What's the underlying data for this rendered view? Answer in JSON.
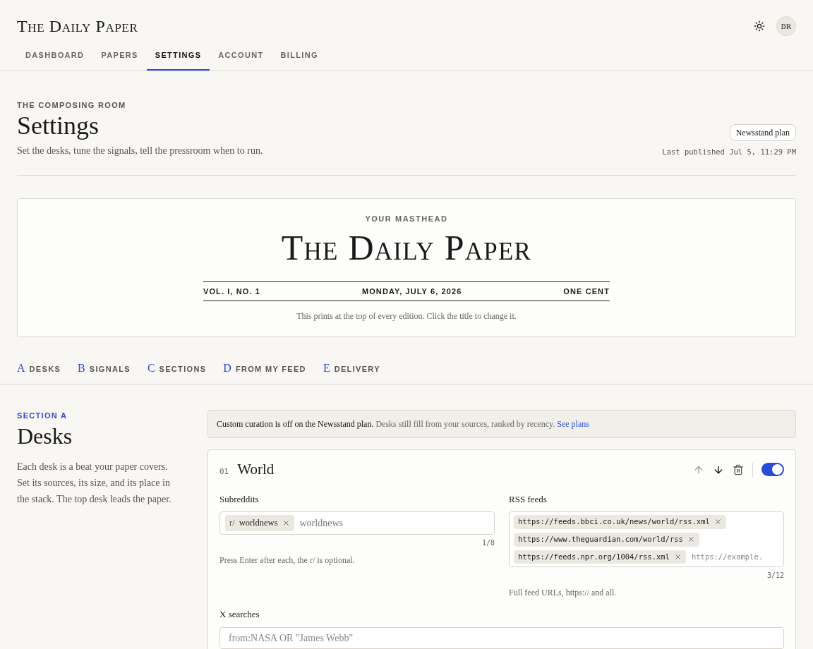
{
  "brand": "The Daily Paper",
  "user": {
    "initials": "DR"
  },
  "tabs": [
    {
      "label": "DASHBOARD",
      "selected": false
    },
    {
      "label": "PAPERS",
      "selected": false
    },
    {
      "label": "SETTINGS",
      "selected": true
    },
    {
      "label": "ACCOUNT",
      "selected": false
    },
    {
      "label": "BILLING",
      "selected": false
    }
  ],
  "page": {
    "eyebrow": "THE COMPOSING ROOM",
    "title": "Settings",
    "subtitle": "Set the desks, tune the signals, tell the pressroom when to run.",
    "plan_badge": "Newsstand plan",
    "last_published": "Last published Jul 5, 11:29 PM"
  },
  "masthead": {
    "eyebrow": "YOUR MASTHEAD",
    "title": "The Daily Paper",
    "volume": "VOL. I, NO. 1",
    "date": "MONDAY, JULY 6, 2026",
    "price": "ONE CENT",
    "note": "This prints at the top of every edition. Click the title to change it."
  },
  "section_nav": [
    {
      "letter": "A",
      "label": "DESKS"
    },
    {
      "letter": "B",
      "label": "SIGNALS"
    },
    {
      "letter": "C",
      "label": "SECTIONS"
    },
    {
      "letter": "D",
      "label": "FROM MY FEED"
    },
    {
      "letter": "E",
      "label": "DELIVERY"
    }
  ],
  "section": {
    "eyebrow": "SECTION A",
    "title": "Desks",
    "description": "Each desk is a beat your paper covers. Set its sources, its size, and its place in the stack. The top desk leads the paper."
  },
  "notice": {
    "bold": "Custom curation is off on the Newsstand plan.",
    "text": "Desks still fill from your sources, ranked by recency.",
    "link": "See plans"
  },
  "desk": {
    "number": "01",
    "name": "World",
    "on": true,
    "move_up_disabled": true,
    "move_down_disabled": false,
    "subreddits": {
      "label": "Subreddits",
      "tags": [
        {
          "prefix": "r/",
          "value": "worldnews"
        }
      ],
      "input": "worldnews",
      "count": "1/8",
      "help": "Press Enter after each, the r/ is optional."
    },
    "rss": {
      "label": "RSS feeds",
      "tags": [
        "https://feeds.bbci.co.uk/news/world/rss.xml",
        "https://www.theguardian.com/world/rss",
        "https://feeds.npr.org/1004/rss.xml"
      ],
      "placeholder": "https://example.",
      "count": "3/12",
      "help": "Full feed URLs, https:// and all."
    },
    "x_searches": {
      "label": "X searches",
      "placeholder": "from:NASA OR \"James Webb\""
    }
  }
}
